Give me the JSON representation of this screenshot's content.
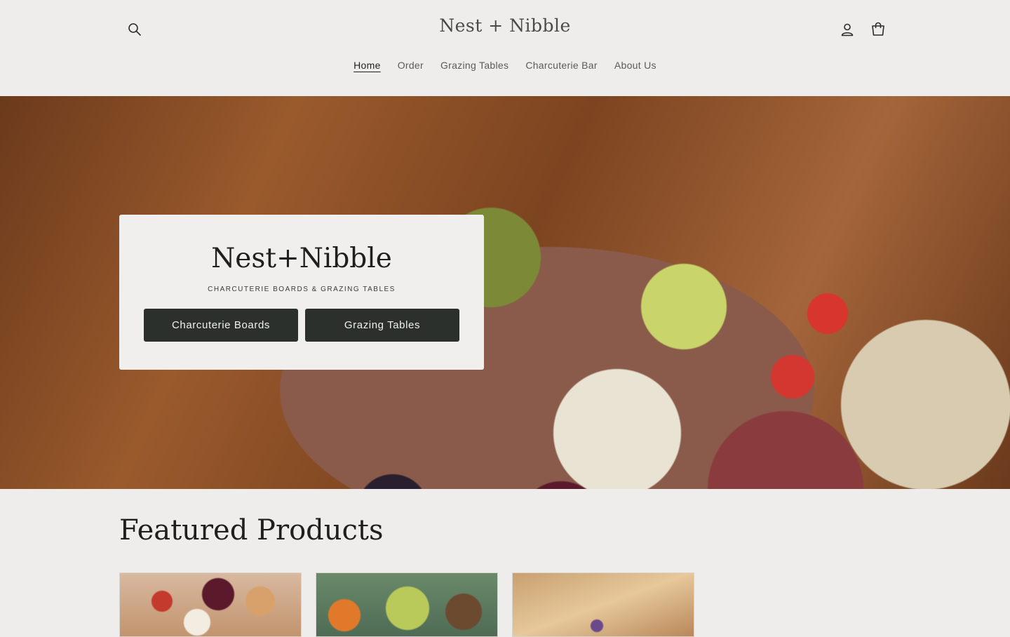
{
  "header": {
    "logo": "Nest + Nibble",
    "search_icon": "search-icon",
    "account_icon": "user-icon",
    "cart_icon": "cart-icon"
  },
  "nav": {
    "items": [
      {
        "label": "Home",
        "active": true
      },
      {
        "label": "Order",
        "active": false
      },
      {
        "label": "Grazing Tables",
        "active": false
      },
      {
        "label": "Charcuterie Bar",
        "active": false
      },
      {
        "label": "About Us",
        "active": false
      }
    ]
  },
  "hero": {
    "title": "Nest+Nibble",
    "subtitle": "CHARCUTERIE BOARDS & GRAZING TABLES",
    "buttons": [
      "Charcuterie Boards",
      "Grazing Tables"
    ]
  },
  "featured": {
    "title": "Featured Products"
  },
  "colors": {
    "background": "#efedeb",
    "button": "#2c302c"
  }
}
